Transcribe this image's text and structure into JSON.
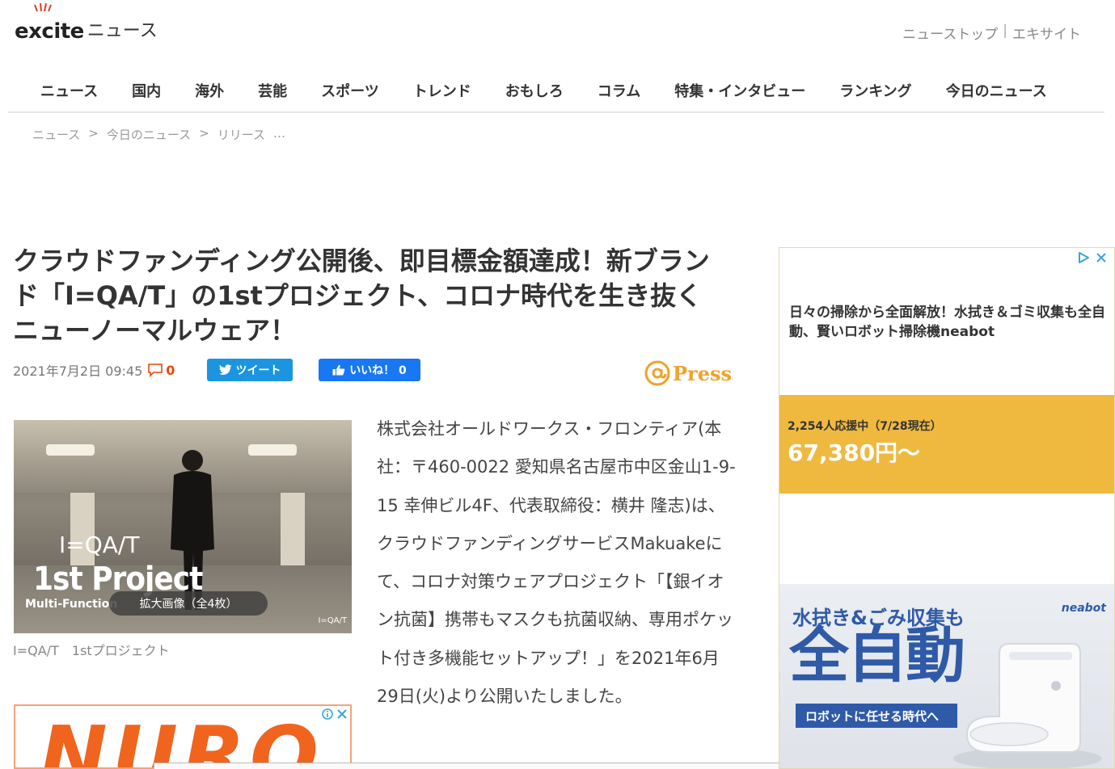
{
  "header": {
    "logo_word": "excite",
    "logo_sub": "ニュース",
    "links": [
      "ニューストップ",
      "エキサイト"
    ],
    "link_separator": "|"
  },
  "nav": {
    "items": [
      "ニュース",
      "国内",
      "海外",
      "芸能",
      "スポーツ",
      "トレンド",
      "おもしろ",
      "コラム",
      "特集・インタビュー",
      "ランキング",
      "今日のニュース"
    ]
  },
  "breadcrumb": {
    "items": [
      "ニュース",
      "今日のニュース",
      "リリース"
    ],
    "separator": ">",
    "ellipsis": "…"
  },
  "article": {
    "title": "クラウドファンディング公開後、即目標金額達成！新ブランド「I=QA/T」の1stプロジェクト、コロナ時代を生き抜くニューノーマルウェア！",
    "date": "2021年7月2日 09:45",
    "comment_count": "0",
    "tweet_label": "ツイート",
    "like_label": "いいね！ 0",
    "press_label": "Press",
    "photo": {
      "brand": "I=QA/T",
      "project": "1st Project",
      "multi": "Multi-Function",
      "enlarge_label": "拡大画像（全4枚）",
      "stamp": "I=QA/T"
    },
    "caption": "I=QA/T　1stプロジェクト",
    "body": "株式会社オールドワークス・フロンティア(本社：〒460-0022 愛知県名古屋市中区金山1-9-15 幸伸ビル4F、代表取締役：横井 隆志)は、クラウドファンディングサービスMakuakeにて、コロナ対策ウェアプロジェクト「【銀イオン抗菌】携帯もマスクも抗菌収納、専用ポケット付き多機能セットアップ！」を2021年6月29日(火)より公開いたしました。"
  },
  "ad_left": {
    "text": "NURO"
  },
  "ad_right": {
    "headline": "日々の掃除から全面解放！水拭き＆ゴミ収集も全自動、賢いロボット掃除機neabot",
    "backers": "2,254人応援中（7/28現在）",
    "price": "67,380円〜",
    "image_line1": "水拭き&ごみ収集も",
    "image_big": "全自動",
    "image_brand": "neabot",
    "image_bar": "ロボットに任せる時代へ"
  },
  "colors": {
    "tweet": "#1b95e0",
    "like": "#1877f2",
    "press": "#f0a22a",
    "comment": "#e8490c",
    "ad_band": "#efb940",
    "ad_blue": "#2f5aa8",
    "nuro": "#f0641e"
  }
}
